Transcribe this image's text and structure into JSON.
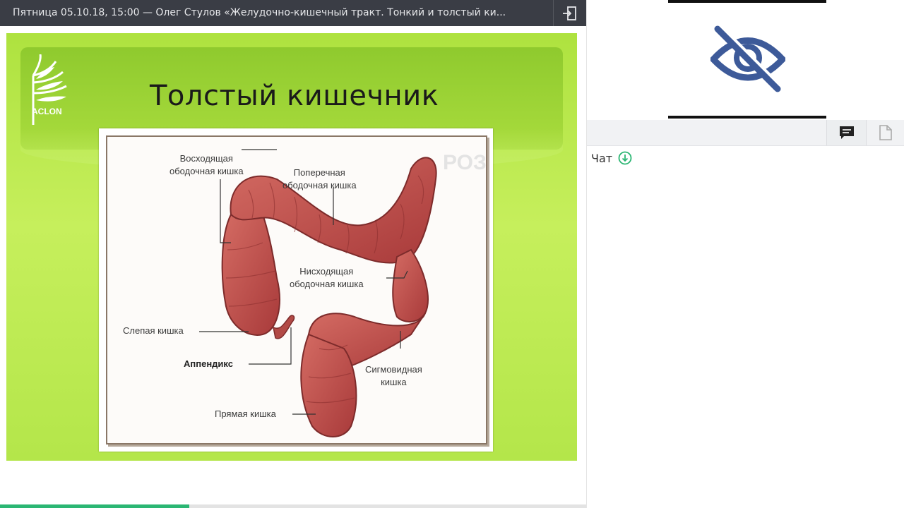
{
  "topbar": {
    "title": "Пятница 05.10.18, 15:00 — Олег Стулов «Желудочно-кишечный тракт. Тонкий и толстый ки...",
    "exit_icon": "exit-icon"
  },
  "slide": {
    "title": "Толстый кишечник",
    "logo_text": "ACLON",
    "watermark": "РОЗ",
    "labels": {
      "ascending": "Восходящая\nободочная кишка",
      "transverse": "Поперечная\nободочная кишка",
      "descending": "Нисходящая\nободочная кишка",
      "cecum": "Слепая кишка",
      "appendix": "Аппендикс",
      "sigmoid": "Сигмовидная\nкишка",
      "rectum": "Прямая кишка"
    }
  },
  "progress": {
    "value": 0.323
  },
  "right_panel": {
    "video_icon": "eye-off-icon",
    "tools": {
      "chat_icon": "chat-icon",
      "docs_icon": "document-icon"
    },
    "chat_title": "Чат",
    "chat_status_icon": "download-circle-icon"
  },
  "colors": {
    "topbar": "#3a3d45",
    "accent": "#2bb673",
    "slide_green": "#b4e64a",
    "eye_icon": "#3d5a99"
  }
}
